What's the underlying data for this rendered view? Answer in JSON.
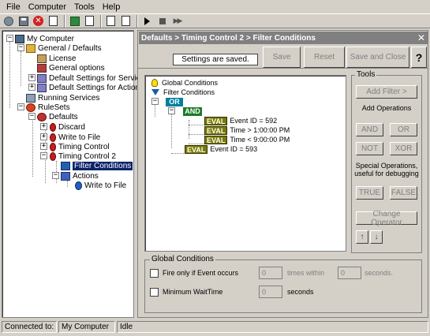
{
  "menu": [
    "File",
    "Computer",
    "Tools",
    "Help"
  ],
  "toolbar_icons": [
    "connect-icon",
    "save-icon",
    "delete-icon",
    "find-icon",
    "view-icon",
    "properties-icon",
    "refresh-icon",
    "settings-icon",
    "play-icon",
    "stop-icon",
    "fast-forward-icon"
  ],
  "tree": {
    "my_computer": "My Computer",
    "general_defaults": "General / Defaults",
    "license": "License",
    "general_options": "General options",
    "default_services": "Default Settings for Services",
    "default_actions": "Default Settings for Actions",
    "running_services": "Running Services",
    "rulesets": "RuleSets",
    "defaults": "Defaults",
    "discard": "Discard",
    "write_to_file": "Write to File",
    "timing_control": "Timing Control",
    "timing_control_2": "Timing Control 2",
    "filter_conditions": "Filter Conditions",
    "actions": "Actions",
    "action_write_to_file": "Write to File"
  },
  "panel": {
    "title": "Defaults > Timing Control 2 > Filter Conditions",
    "save_status": "Settings are saved.",
    "save_btn": "Save",
    "reset_btn": "Reset",
    "save_close_btn": "Save and Close",
    "help_btn": "?"
  },
  "conditions": {
    "global": "Global Conditions",
    "filter": "Filter Conditions",
    "or": "OR",
    "and": "AND",
    "eval": "EVAL",
    "e1": "Event ID = 592",
    "e2": "Time > 1:00:00 PM",
    "e3": "Time < 9:00:00 PM",
    "e4": "Event ID = 593"
  },
  "tools": {
    "label": "Tools",
    "add_filter": "Add Filter >",
    "add_operations": "Add Operations",
    "and": "AND",
    "or": "OR",
    "not": "NOT",
    "xor": "XOR",
    "special_ops_1": "Special Operations,",
    "special_ops_2": "useful for debugging",
    "true": "TRUE",
    "false": "FALSE",
    "change_operator": "Change Operator",
    "up": "↑",
    "down": "↓"
  },
  "global_conditions": {
    "label": "Global Conditions",
    "fire_only": "Fire only if Event occurs",
    "fire_value": "0",
    "times_within": "times within",
    "seconds_value": "0",
    "seconds_label": "seconds.",
    "min_wait": "Minimum WaitTime",
    "wait_value": "0",
    "wait_seconds": "seconds"
  },
  "status": {
    "connected_label": "Connected to:",
    "computer": "My Computer",
    "state": "Idle"
  }
}
